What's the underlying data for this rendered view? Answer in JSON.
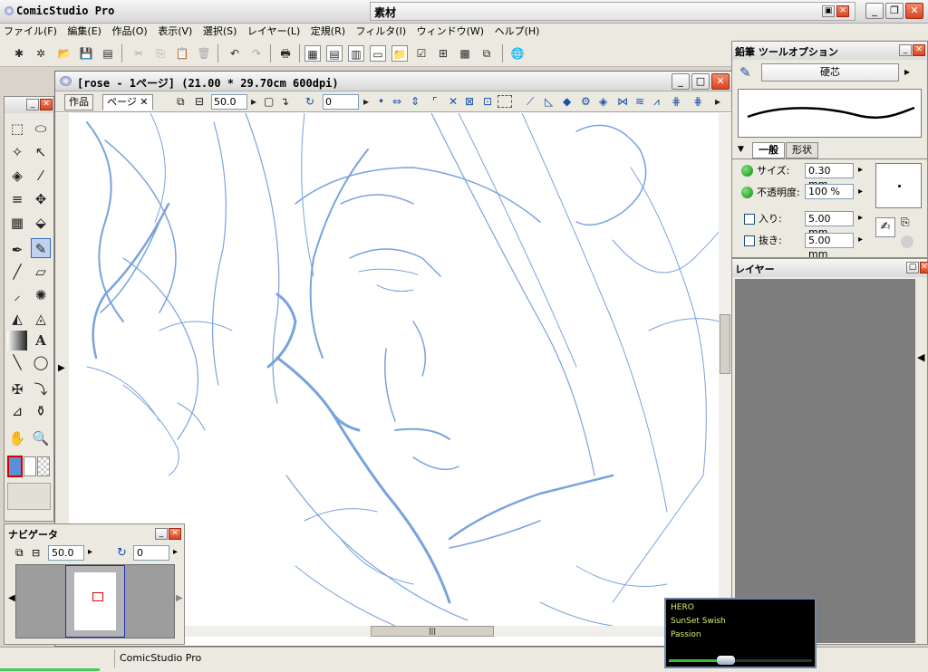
{
  "app": {
    "title": "ComicStudio Pro",
    "sozai_label": "素材"
  },
  "menu": [
    "ファイル(F)",
    "編集(E)",
    "作品(O)",
    "表示(V)",
    "選択(S)",
    "レイヤー(L)",
    "定規(R)",
    "フィルタ(I)",
    "ウィンドウ(W)",
    "ヘルプ(H)"
  ],
  "document": {
    "title": "[rose - 1ページ] (21.00 * 29.70cm 600dpi)",
    "tabs": [
      "作品",
      "ページ"
    ],
    "zoom": "50.0",
    "rotation": "0"
  },
  "navigator": {
    "title": "ナビゲータ",
    "zoom": "50.0",
    "rotation": "0"
  },
  "tool_options": {
    "title": "鉛筆 ツールオプション",
    "preset": "硬芯",
    "tabs": [
      "一般",
      "形状"
    ],
    "size_label": "サイズ:",
    "size_value": "0.30 mm",
    "opacity_label": "不透明度:",
    "opacity_value": "100 %",
    "in_label": "入り:",
    "in_value": "5.00 mm",
    "out_label": "抜き:",
    "out_value": "5.00 mm"
  },
  "layers": {
    "title": "レイヤー"
  },
  "status": {
    "text": "ComicStudio Pro"
  },
  "music": {
    "lines": [
      "HERO",
      "SunSet Swish",
      "Passion"
    ]
  },
  "colors": {
    "sketch_blue": "#79a3dd",
    "accent_green": "#0e8a12",
    "selection": "#316ac5"
  }
}
